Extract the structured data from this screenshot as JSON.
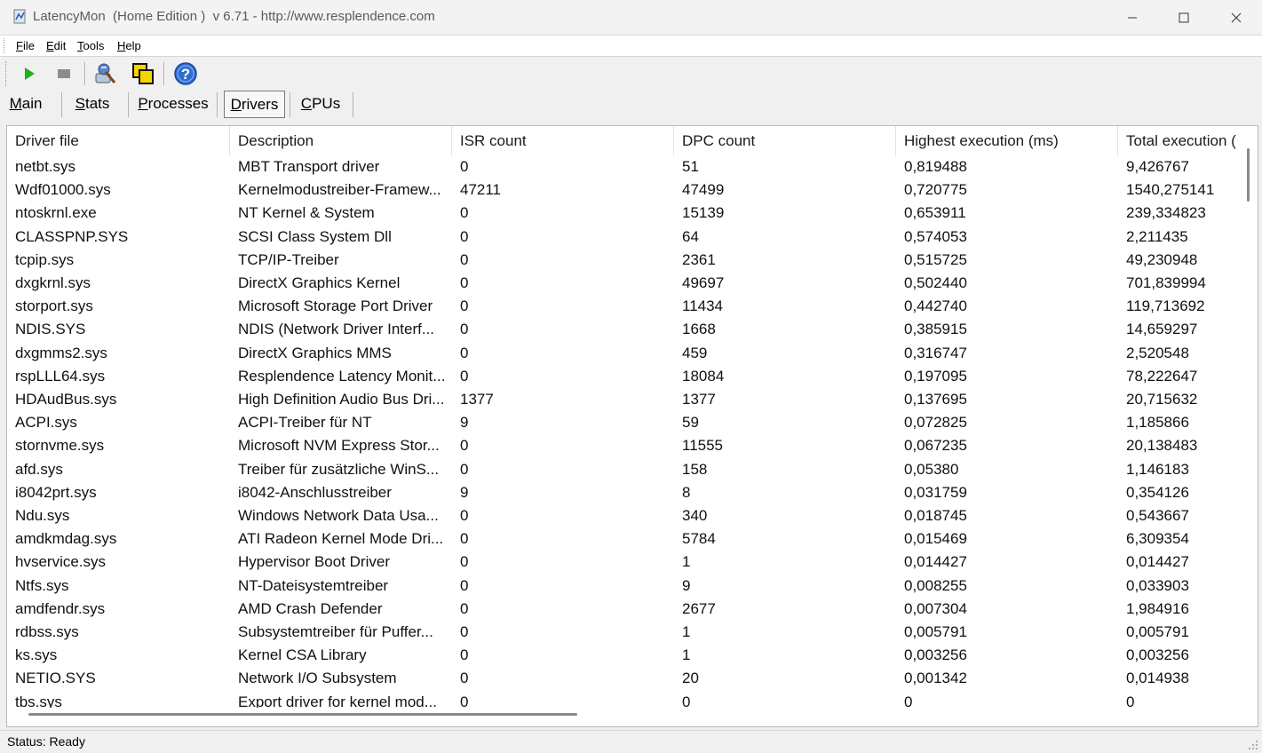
{
  "window": {
    "title": "LatencyMon  (Home Edition )  v 6.71 - http://www.resplendence.com"
  },
  "menu": [
    {
      "hot": "F",
      "rest": "ile"
    },
    {
      "hot": "E",
      "rest": "dit"
    },
    {
      "hot": "T",
      "rest": "ools"
    },
    {
      "hot": "H",
      "rest": "elp"
    }
  ],
  "toolbar": {
    "icons": [
      "play-icon",
      "stop-icon",
      "driver-tools-icon",
      "window-copy-icon",
      "help-icon"
    ]
  },
  "tabs": [
    {
      "hot": "M",
      "rest": "ain",
      "active": false
    },
    {
      "hot": "S",
      "rest": "tats",
      "active": false
    },
    {
      "hot": "P",
      "rest": "rocesses",
      "active": false
    },
    {
      "hot": "D",
      "rest": "rivers",
      "active": true
    },
    {
      "hot": "C",
      "rest": "PUs",
      "active": false
    }
  ],
  "table": {
    "columns": [
      "Driver file",
      "Description",
      "ISR count",
      "DPC count",
      "Highest execution (ms)",
      "Total execution ("
    ],
    "rows": [
      [
        "netbt.sys",
        "MBT Transport driver",
        "0",
        "51",
        "0,819488",
        "9,426767"
      ],
      [
        "Wdf01000.sys",
        "Kernelmodustreiber-Framew...",
        "47211",
        "47499",
        "0,720775",
        "1540,275141"
      ],
      [
        "ntoskrnl.exe",
        "NT Kernel & System",
        "0",
        "15139",
        "0,653911",
        "239,334823"
      ],
      [
        "CLASSPNP.SYS",
        "SCSI Class System Dll",
        "0",
        "64",
        "0,574053",
        "2,211435"
      ],
      [
        "tcpip.sys",
        "TCP/IP-Treiber",
        "0",
        "2361",
        "0,515725",
        "49,230948"
      ],
      [
        "dxgkrnl.sys",
        "DirectX Graphics Kernel",
        "0",
        "49697",
        "0,502440",
        "701,839994"
      ],
      [
        "storport.sys",
        "Microsoft Storage Port Driver",
        "0",
        "11434",
        "0,442740",
        "119,713692"
      ],
      [
        "NDIS.SYS",
        "NDIS (Network Driver Interf...",
        "0",
        "1668",
        "0,385915",
        "14,659297"
      ],
      [
        "dxgmms2.sys",
        "DirectX Graphics MMS",
        "0",
        "459",
        "0,316747",
        "2,520548"
      ],
      [
        "rspLLL64.sys",
        "Resplendence Latency Monit...",
        "0",
        "18084",
        "0,197095",
        "78,222647"
      ],
      [
        "HDAudBus.sys",
        "High Definition Audio Bus Dri...",
        "1377",
        "1377",
        "0,137695",
        "20,715632"
      ],
      [
        "ACPI.sys",
        "ACPI-Treiber für NT",
        "9",
        "59",
        "0,072825",
        "1,185866"
      ],
      [
        "stornvme.sys",
        "Microsoft NVM Express Stor...",
        "0",
        "11555",
        "0,067235",
        "20,138483"
      ],
      [
        "afd.sys",
        "Treiber für zusätzliche WinS...",
        "0",
        "158",
        "0,05380",
        "1,146183"
      ],
      [
        "i8042prt.sys",
        "i8042-Anschlusstreiber",
        "9",
        "8",
        "0,031759",
        "0,354126"
      ],
      [
        "Ndu.sys",
        "Windows Network Data Usa...",
        "0",
        "340",
        "0,018745",
        "0,543667"
      ],
      [
        "amdkmdag.sys",
        "ATI Radeon Kernel Mode Dri...",
        "0",
        "5784",
        "0,015469",
        "6,309354"
      ],
      [
        "hvservice.sys",
        "Hypervisor Boot Driver",
        "0",
        "1",
        "0,014427",
        "0,014427"
      ],
      [
        "Ntfs.sys",
        "NT-Dateisystemtreiber",
        "0",
        "9",
        "0,008255",
        "0,033903"
      ],
      [
        "amdfendr.sys",
        "AMD Crash Defender",
        "0",
        "2677",
        "0,007304",
        "1,984916"
      ],
      [
        "rdbss.sys",
        "Subsystemtreiber für Puffer...",
        "0",
        "1",
        "0,005791",
        "0,005791"
      ],
      [
        "ks.sys",
        "Kernel CSA Library",
        "0",
        "1",
        "0,003256",
        "0,003256"
      ],
      [
        "NETIO.SYS",
        "Network I/O Subsystem",
        "0",
        "20",
        "0,001342",
        "0,014938"
      ],
      [
        "tbs.sys",
        "Export driver for kernel mod...",
        "0",
        "0",
        "0",
        "0"
      ]
    ]
  },
  "status": {
    "text": "Status: Ready"
  }
}
